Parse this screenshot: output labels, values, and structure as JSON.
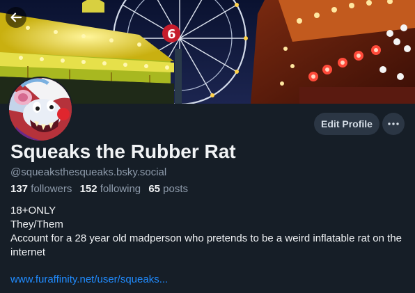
{
  "profile": {
    "display_name": "Squeaks the Rubber Rat",
    "handle": "@squeaksthesqueaks.bsky.social",
    "stats": {
      "followers_count": "137",
      "followers_label": "followers",
      "following_count": "152",
      "following_label": "following",
      "posts_count": "65",
      "posts_label": "posts"
    },
    "bio": {
      "line1": "18+ONLY",
      "line2": "They/Them",
      "line3": "Account for a 28 year old madperson who pretends to be a weird inflatable rat on the internet"
    },
    "link": "www.furaffinity.net/user/squeaks..."
  },
  "actions": {
    "edit_profile_label": "Edit Profile"
  },
  "icons": {
    "back": "arrow-left-icon",
    "more": "more-horizontal-icon"
  },
  "colors": {
    "background": "#161e27",
    "button_bg": "#2b3644",
    "muted_text": "#8e9bab",
    "link": "#208bfe"
  }
}
